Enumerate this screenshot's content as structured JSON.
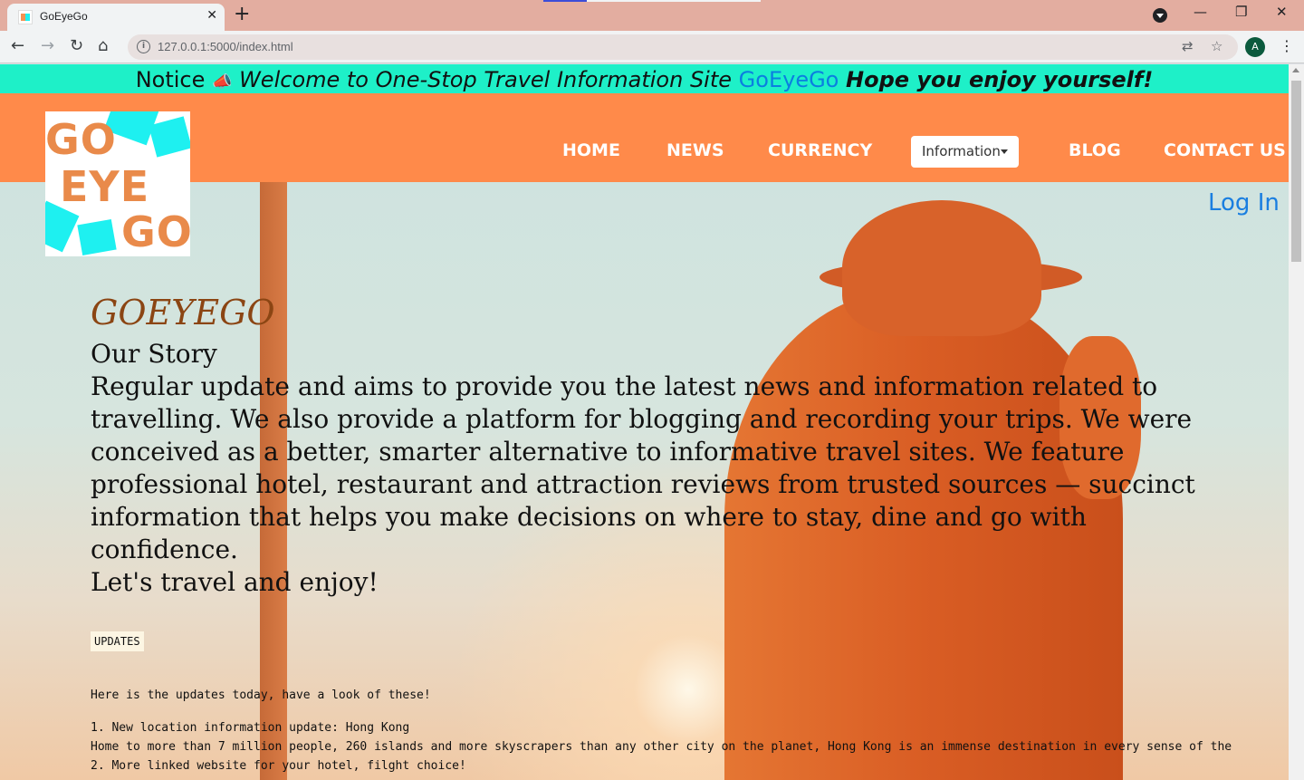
{
  "browser": {
    "tab_title": "GoEyeGo",
    "url": "127.0.0.1:5000/index.html",
    "profile_initial": "A"
  },
  "notice": {
    "label": "Notice",
    "icon": "megaphone-icon",
    "welcome": "Welcome to One-Stop Travel Information Site",
    "brand": "GoEyeGo",
    "hope": "Hope you enjoy yourself!"
  },
  "logo": {
    "line1": "GO",
    "line2": "EYE",
    "line3": "GO"
  },
  "nav": {
    "home": "HOME",
    "news": "NEWS",
    "currency": "CURRENCY",
    "information": "Information",
    "blog": "BLOG",
    "contact": "CONTACT US"
  },
  "login": "Log In",
  "main": {
    "title": "GOEYEGO",
    "story_heading": "Our Story",
    "story_text": "Regular update and aims to provide you the latest news and information related to travelling. We also provide a platform for blogging and recording your trips. We were conceived as a better, smarter alternative to informative travel sites. We feature professional hotel, restaurant and attraction reviews from trusted sources — succinct information that helps you make decisions on where to stay, dine and go with confidence.",
    "closing": "Let's travel and enjoy!",
    "updates_badge": "UPDATES",
    "updates_intro": "Here is the updates today, have a look of these!",
    "updates": [
      "1. New location information update: Hong Kong",
      "Home to more than 7 million people, 260 islands and more skyscrapers than any other city on the planet, Hong Kong is an immense destination in every sense of the",
      "2. More linked website for your hotel, filght choice!"
    ]
  },
  "colors": {
    "notice_bg": "#1ef0c8",
    "navbar_bg": "#ff8a4a",
    "brand_blue": "#0b7fe0",
    "title_brown": "#8b4513",
    "tabstrip": "#e3ada0"
  }
}
